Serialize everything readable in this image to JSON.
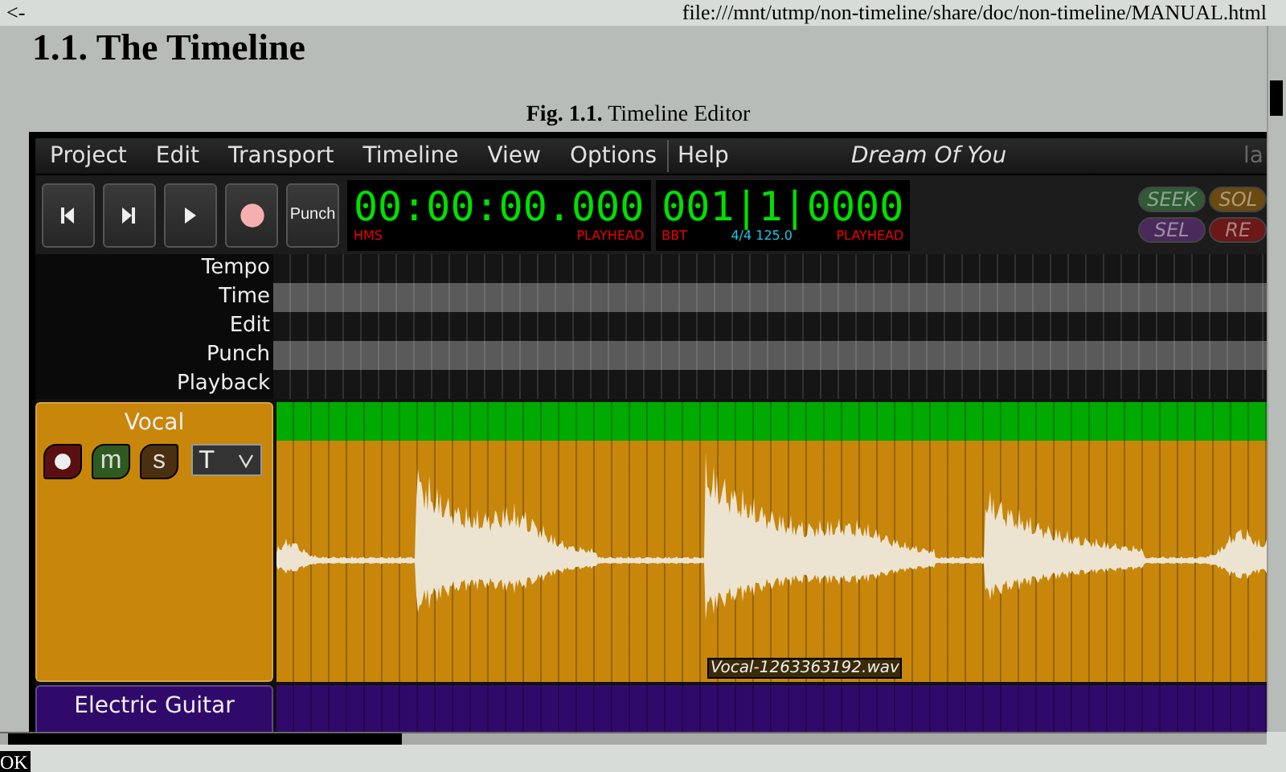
{
  "browser": {
    "back": "<-",
    "url": "file:///mnt/utmp/non-timeline/share/doc/non-timeline/MANUAL.html",
    "status": "OK"
  },
  "document": {
    "heading": "1.1. The Timeline",
    "caption": "**Fig. 1.1.** Timeline Editor"
  },
  "app": {
    "menus": [
      "Project",
      "Edit",
      "Transport",
      "Timeline",
      "View",
      "Options"
    ],
    "help_menu": "Help",
    "project_title": "Dream Of You",
    "title_cut": "la",
    "punch_button": "Punch",
    "clocks": [
      {
        "value": "00:00:00.000",
        "format": "HMS",
        "mode": "PLAYHEAD"
      },
      {
        "value": "001|1|0000",
        "format": "BBT",
        "signature": "4/4 125.0",
        "mode": "PLAYHEAD"
      }
    ],
    "mode_buttons": [
      {
        "label": "SEEK",
        "color": "#2f5a34"
      },
      {
        "label": "SOL",
        "color": "#6a4a10"
      },
      {
        "label": "SEL",
        "color": "#4a2a5a"
      },
      {
        "label": "RE",
        "color": "#6a1818"
      }
    ],
    "rulers": [
      {
        "label": "Tempo",
        "shaded": false
      },
      {
        "label": "Time",
        "shaded": true
      },
      {
        "label": "Edit",
        "shaded": false
      },
      {
        "label": "Punch",
        "shaded": true
      },
      {
        "label": "Playback",
        "shaded": false
      }
    ],
    "tracks": [
      {
        "name": "Vocal",
        "color": "#c8860a",
        "mute": "m",
        "solo": "s",
        "mode": "T",
        "clip": "Vocal-1263363192.wav"
      },
      {
        "name": "Electric Guitar",
        "color": "#300a6a"
      }
    ]
  }
}
